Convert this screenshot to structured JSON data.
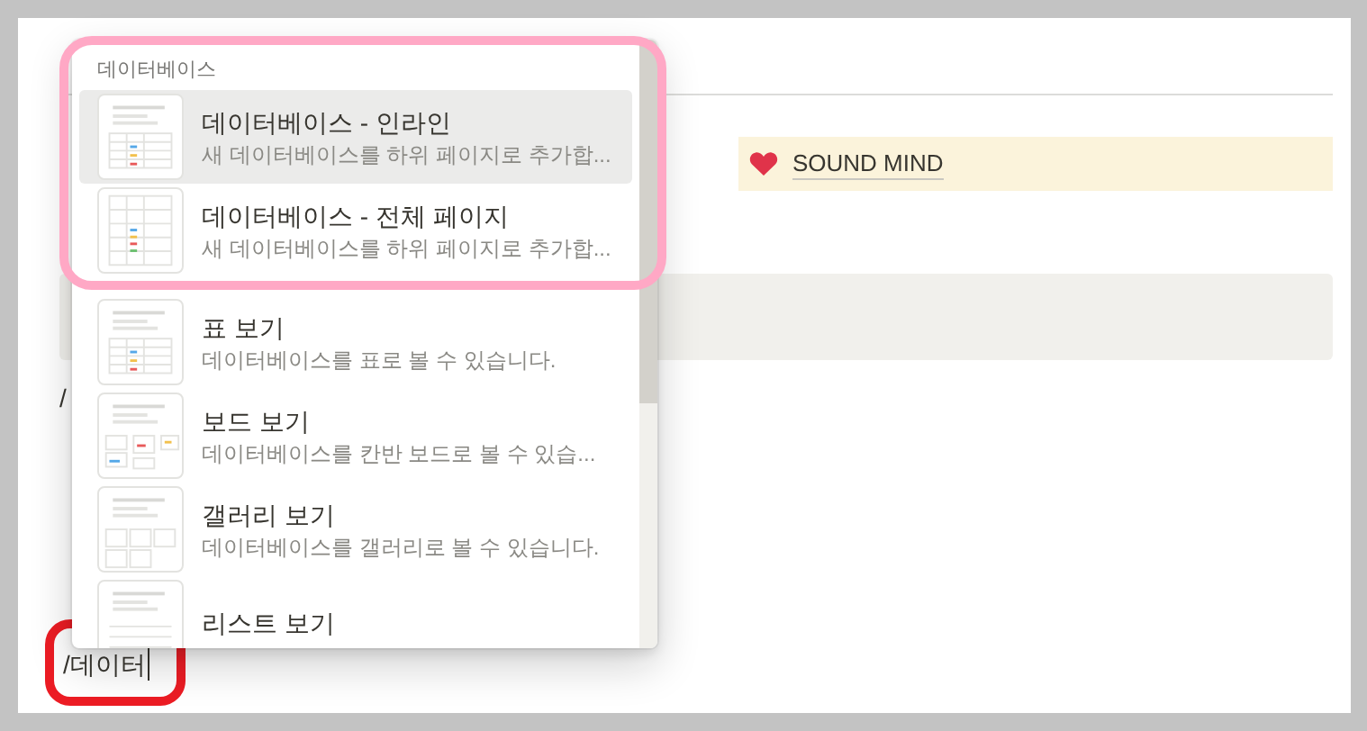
{
  "page": {
    "callout": {
      "text": "SOUND MIND"
    },
    "fragment": "/",
    "command_input": {
      "value": "/데이터"
    }
  },
  "menu": {
    "section_title": "데이터베이스",
    "items": [
      {
        "title": "데이터베이스 - 인라인",
        "description": "새 데이터베이스를 하위 페이지로 추가합...",
        "kind": "table",
        "selected": true
      },
      {
        "title": "데이터베이스 - 전체 페이지",
        "description": "새 데이터베이스를 하위 페이지로 추가합...",
        "kind": "fulltable",
        "selected": false
      },
      {
        "title": "표 보기",
        "description": "데이터베이스를 표로 볼 수 있습니다.",
        "kind": "table",
        "selected": false
      },
      {
        "title": "보드 보기",
        "description": "데이터베이스를 칸반 보드로 볼 수 있습...",
        "kind": "board",
        "selected": false
      },
      {
        "title": "갤러리 보기",
        "description": "데이터베이스를 갤러리로 볼 수 있습니다.",
        "kind": "gallery",
        "selected": false
      },
      {
        "title": "리스트 보기",
        "kind": "list",
        "selected": false
      }
    ]
  }
}
